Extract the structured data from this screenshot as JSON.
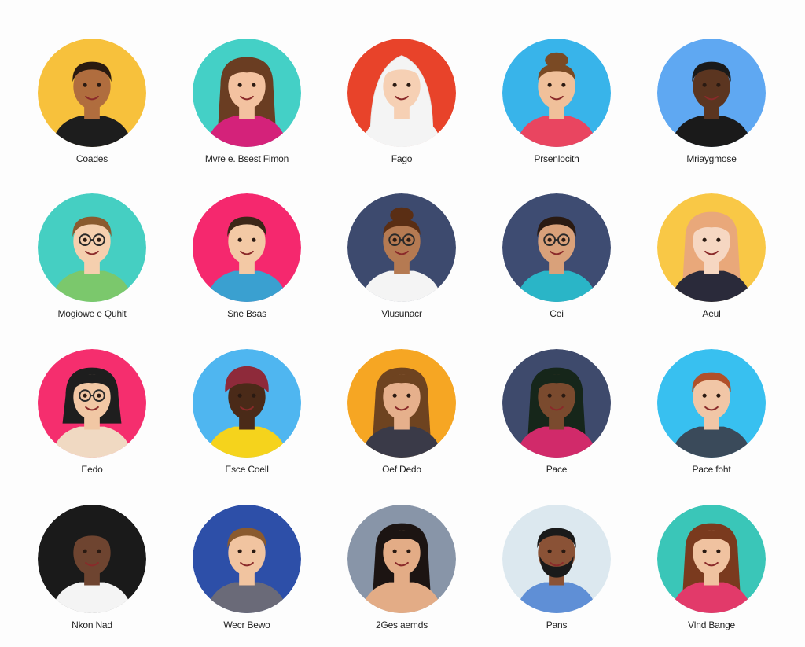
{
  "avatars": [
    {
      "name": "Coades",
      "bg": "#f7c13c",
      "skin": "#b06d3e",
      "hair": "#2a1a10",
      "shirt": "#1d1d1d",
      "style": "short"
    },
    {
      "name": "Mvre e. Bsest Fimon",
      "bg": "#44d0c6",
      "skin": "#f3c2a0",
      "hair": "#6a3d22",
      "shirt": "#d4227a",
      "style": "long"
    },
    {
      "name": "Fago",
      "bg": "#e8432a",
      "skin": "#f6d0b4",
      "hair": "#f4f4f4",
      "shirt": "#f4f4f4",
      "style": "hijab"
    },
    {
      "name": "Prsenlocith",
      "bg": "#38b4ea",
      "skin": "#f0c09a",
      "hair": "#7a4a24",
      "shirt": "#e94560",
      "style": "bun"
    },
    {
      "name": "Mriaygmose",
      "bg": "#5fa8f2",
      "skin": "#5b3520",
      "hair": "#1a1a1a",
      "shirt": "#1a1a1a",
      "style": "short"
    },
    {
      "name": "Mogiowe e Quhit",
      "bg": "#45cfc2",
      "skin": "#f5cfae",
      "hair": "#8a5a2e",
      "shirt": "#7bc86c",
      "style": "short-glasses"
    },
    {
      "name": "Sne Bsas",
      "bg": "#f5286e",
      "skin": "#f3c9a5",
      "hair": "#3b2718",
      "shirt": "#3aa0d0",
      "style": "short"
    },
    {
      "name": "Vlusunacr",
      "bg": "#3d4a6e",
      "skin": "#b57a52",
      "hair": "#5a2e14",
      "shirt": "#f4f4f4",
      "style": "bun-glasses"
    },
    {
      "name": "Cei",
      "bg": "#3e4c72",
      "skin": "#d9a17a",
      "hair": "#2a1a12",
      "shirt": "#2ab5c7",
      "style": "short-glasses"
    },
    {
      "name": "Aeul",
      "bg": "#f9c846",
      "skin": "#f6d7c2",
      "hair": "#e9a87a",
      "shirt": "#2a2a3a",
      "style": "long"
    },
    {
      "name": "Eedo",
      "bg": "#f52e6e",
      "skin": "#f1c7a4",
      "hair": "#1e1e1e",
      "shirt": "#f0d9c2",
      "style": "bob-glasses"
    },
    {
      "name": "Esce Coell",
      "bg": "#4fb6f0",
      "skin": "#4a2a18",
      "hair": "#8e2a3a",
      "shirt": "#f5d31c",
      "style": "turban"
    },
    {
      "name": "Oef Dedo",
      "bg": "#f6a623",
      "skin": "#e6b08c",
      "hair": "#6e4320",
      "shirt": "#3a3a48",
      "style": "long"
    },
    {
      "name": "Pace",
      "bg": "#3e4a6c",
      "skin": "#7a4a2e",
      "hair": "#16261a",
      "shirt": "#d12a6a",
      "style": "long"
    },
    {
      "name": "Pace foht",
      "bg": "#38c0f0",
      "skin": "#f1c6a6",
      "hair": "#b0502a",
      "shirt": "#3a4a5a",
      "style": "short"
    },
    {
      "name": "Nkon Nad",
      "bg": "#1a1a1a",
      "skin": "#6e4430",
      "hair": "#1a1a1a",
      "shirt": "#f4f4f4",
      "style": "short"
    },
    {
      "name": "Wecr Bewo",
      "bg": "#2d4fa8",
      "skin": "#f1c4a0",
      "hair": "#8a5a2e",
      "shirt": "#6a6a78",
      "style": "short"
    },
    {
      "name": "2Ges aemds",
      "bg": "#8895a8",
      "skin": "#e3ac86",
      "hair": "#1c1412",
      "shirt": "#e3ac86",
      "style": "long"
    },
    {
      "name": "Pans",
      "bg": "#dce8ef",
      "skin": "#8a5236",
      "hair": "#1a1a1a",
      "shirt": "#5f8fd6",
      "style": "beard"
    },
    {
      "name": "Vlnd Bange",
      "bg": "#3ac6b8",
      "skin": "#f0c2a0",
      "hair": "#7a3a1e",
      "shirt": "#e23a6a",
      "style": "long"
    }
  ]
}
